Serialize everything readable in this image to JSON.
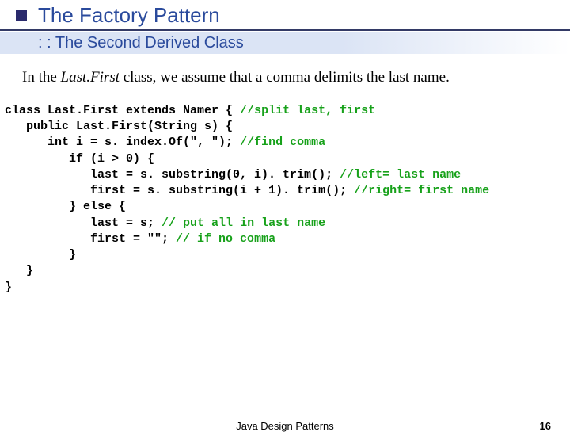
{
  "header": {
    "title": "The Factory Pattern",
    "subtitle": ": : The Second Derived Class"
  },
  "body": {
    "para_pre": "In the ",
    "para_em": "Last.First",
    "para_post": " class, we assume that a comma delimits the last name."
  },
  "code": {
    "l1a": "class Last.First extends Namer { ",
    "l1c": "//split last, first",
    "l2": "   public Last.First(String s) {",
    "l3a": "      int i = s. index.Of(\", \"); ",
    "l3c": "//find comma",
    "l4": "         if (i > 0) {",
    "l5a": "            last = s. substring(0, i). trim(); ",
    "l5c": "//left= last name",
    "l6a": "            first = s. substring(i + 1). trim(); ",
    "l6c": "//right= first name",
    "l7": "         } else {",
    "l8a": "            last = s; ",
    "l8c": "// put all in last name",
    "l9a": "            first = \"\"; ",
    "l9c": "// if no comma",
    "l10": "         }",
    "l11": "   }",
    "l12": "}"
  },
  "footer": {
    "center": "Java Design Patterns",
    "page": "16"
  }
}
